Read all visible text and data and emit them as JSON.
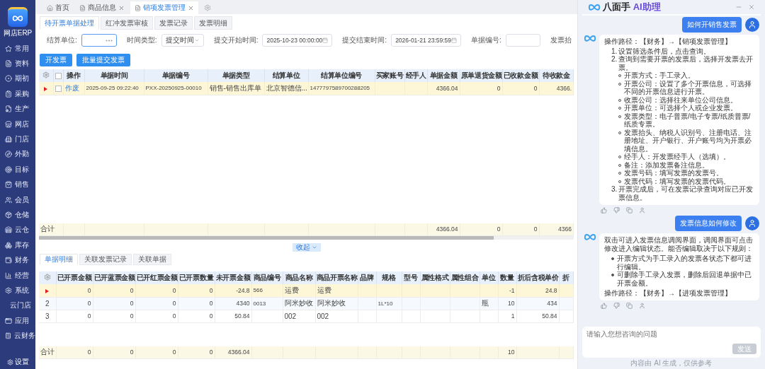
{
  "sidebar": {
    "logo_text": "网店ERP",
    "items": [
      {
        "label": "常用",
        "kind": "main"
      },
      {
        "label": "资料",
        "kind": "main"
      },
      {
        "label": "期初",
        "kind": "main"
      },
      {
        "label": "采购",
        "kind": "main"
      },
      {
        "label": "生产",
        "kind": "main"
      },
      {
        "label": "网店",
        "kind": "main"
      },
      {
        "label": "门店",
        "kind": "main"
      },
      {
        "label": "外勤",
        "kind": "main"
      },
      {
        "label": "目标",
        "kind": "main"
      },
      {
        "label": "销售",
        "kind": "main"
      },
      {
        "label": "会员",
        "kind": "main"
      },
      {
        "label": "仓储",
        "kind": "main"
      },
      {
        "label": "云仓",
        "kind": "main"
      },
      {
        "label": "库存",
        "kind": "main"
      },
      {
        "label": "财务",
        "kind": "main"
      },
      {
        "label": "经营",
        "kind": "main"
      },
      {
        "label": "系统",
        "kind": "main"
      },
      {
        "label": "云门店",
        "kind": "sub"
      },
      {
        "label": "应用",
        "kind": "main"
      },
      {
        "label": "云财务",
        "kind": "main"
      }
    ],
    "footer": "设置"
  },
  "page_tabs": [
    {
      "label": "首页",
      "selected": false,
      "closable": false
    },
    {
      "label": "商品信息",
      "selected": false,
      "closable": true
    },
    {
      "label": "销项发票管理",
      "selected": true,
      "closable": true
    }
  ],
  "sub_tabs": [
    {
      "label": "待开票单据处理",
      "selected": true
    },
    {
      "label": "红冲发票审核",
      "selected": false
    },
    {
      "label": "发票记录",
      "selected": false
    },
    {
      "label": "发票明细",
      "selected": false
    }
  ],
  "filters": [
    {
      "label": "结算单位:",
      "kind": "lookup"
    },
    {
      "label": "时间类型:",
      "kind": "select",
      "value": "提交时间"
    },
    {
      "label": "提交开始时间:",
      "kind": "date",
      "value": "2025-10-23 00:00:00"
    },
    {
      "label": "提交结束时间:",
      "kind": "date",
      "value": "2026-01-21 23:59:59"
    },
    {
      "label": "单据编号:",
      "kind": "text"
    },
    {
      "label": "发票抬",
      "kind": "label"
    }
  ],
  "actions": [
    "开发票",
    "批量提交发票"
  ],
  "upper_table": {
    "header_checked": false,
    "columns": [
      {
        "label": "操作",
        "kind": "action"
      },
      {
        "label": "单据时间",
        "kind": "code"
      },
      {
        "label": "单据编号",
        "kind": "code"
      },
      {
        "label": "单据类型",
        "kind": "text"
      },
      {
        "label": "结算单位",
        "kind": "text"
      },
      {
        "label": "结算单位编号",
        "kind": "code"
      },
      {
        "label": "买家账号",
        "kind": "text"
      },
      {
        "label": "经手人",
        "kind": "text"
      },
      {
        "label": "单据金额",
        "kind": "number"
      },
      {
        "label": "原单退货金额",
        "kind": "number"
      },
      {
        "label": "已收款金额",
        "kind": "number"
      },
      {
        "label": "待收款金",
        "kind": "number"
      }
    ],
    "rows": [
      {
        "selected": true,
        "checked": false,
        "cells": [
          "作废",
          "2025-09-25 09:22:40",
          "PXX-20250925-00010",
          "销售-销售出库单",
          "北京智德信...",
          "1477797589700288205",
          null,
          null,
          "4366.04",
          "0",
          "0",
          "4366."
        ]
      }
    ],
    "total": {
      "label": "合计",
      "cells": [
        null,
        null,
        null,
        null,
        null,
        null,
        null,
        null,
        "4366.04",
        "0",
        "0",
        "4366"
      ]
    }
  },
  "collapse": "收起",
  "detail_tabs": [
    {
      "label": "单据明细",
      "selected": true
    },
    {
      "label": "关联发票记录",
      "selected": false
    },
    {
      "label": "关联单据",
      "selected": false
    }
  ],
  "lower_table": {
    "columns": [
      {
        "label": "已开票金额",
        "kind": "number"
      },
      {
        "label": "已开蓝票金额",
        "kind": "number"
      },
      {
        "label": "已开红票金额",
        "kind": "number"
      },
      {
        "label": "已开票数量",
        "kind": "number"
      },
      {
        "label": "未开票金额",
        "kind": "number"
      },
      {
        "label": "商品编号",
        "kind": "code"
      },
      {
        "label": "商品名称",
        "kind": "text"
      },
      {
        "label": "商品开票名称",
        "kind": "text"
      },
      {
        "label": "品牌",
        "kind": "text"
      },
      {
        "label": "规格",
        "kind": "code"
      },
      {
        "label": "型号",
        "kind": "text"
      },
      {
        "label": "属性格式",
        "kind": "text"
      },
      {
        "label": "属性组合",
        "kind": "text"
      },
      {
        "label": "单位",
        "kind": "text"
      },
      {
        "label": "数量",
        "kind": "number"
      },
      {
        "label": "折后含税单价",
        "kind": "number"
      },
      {
        "label": "折",
        "kind": "number"
      }
    ],
    "rows": [
      {
        "selected": true,
        "cells": [
          "0",
          "0",
          "0",
          "0",
          "-24.8",
          "566",
          "运费",
          "运费",
          null,
          null,
          null,
          null,
          null,
          null,
          "-1",
          "24.8",
          null
        ]
      },
      {
        "selected": false,
        "index": "2",
        "cells": [
          "0",
          "0",
          "0",
          "0",
          "4340",
          "0013",
          "阿米妙收",
          "阿米妙收",
          null,
          "1L*10",
          null,
          null,
          null,
          "瓶",
          "10",
          "434",
          null
        ]
      },
      {
        "selected": false,
        "index": "3",
        "cells": [
          "0",
          "0",
          "0",
          "0",
          "50.84",
          null,
          "002",
          "002",
          null,
          null,
          null,
          null,
          null,
          null,
          "1",
          "50.84",
          null
        ]
      }
    ],
    "total": {
      "label": "合计",
      "cells": [
        "0",
        "0",
        "0",
        "0",
        "4366.04",
        null,
        null,
        null,
        null,
        null,
        null,
        null,
        null,
        null,
        "10",
        null,
        null
      ]
    }
  },
  "assistant": {
    "title_main": "八面手 ",
    "title_accent": "AI助理",
    "messages": [
      {
        "kind": "question",
        "text": "如何开销售发票"
      },
      {
        "kind": "answer",
        "blocks": [
          {
            "kind": "paragraph",
            "text": "操作路径：【财务】→【销项发票管理】"
          },
          {
            "kind": "ordered",
            "items": [
              {
                "number": "1.",
                "text": "设置筛选条件后，点击查询。"
              },
              {
                "number": "2.",
                "text": "查询到需要开票的发票后，选择开发票去开票。",
                "children": [
                  "开票方式：手工录入。",
                  "开票公司：设置了多个开票信息，可选择不同的开票信息进行开票。",
                  "收票公司：选择往来单位公司信息。",
                  "开票单位：可选择个人或企业发票。",
                  "发票类型：电子普票/电子专票/纸质普票/纸质专票。",
                  "发票抬头、纳税人识别号、注册电话、注册地址、开户银行、开户账号均为开票必填信息。",
                  "经手人：开发票经手人（选填）。",
                  "备注：添加发票备注信息。",
                  "发票号码：填写发票的发票号。",
                  "发票代码：填写发票的发票代码。"
                ]
              },
              {
                "number": "3.",
                "text": "开票完成后，可在发票记录查询对应已开发票信息。"
              }
            ]
          }
        ]
      },
      {
        "kind": "question",
        "text": "发票信息如何修改"
      },
      {
        "kind": "answer",
        "blocks": [
          {
            "kind": "paragraph",
            "text": "双击可进入发票信息调阅界面，调阅界面可点击修改进入编辑状态。能否编辑取决于以下规则："
          },
          {
            "kind": "bullets",
            "items": [
              "开票方式为手工录入的发票各状态下都可进行编辑。",
              "可删除手工录入发票，删除后回退单据中已开票金额。"
            ]
          },
          {
            "kind": "paragraph",
            "text": "操作路径：【财务】→【进项发票管理】"
          }
        ]
      }
    ],
    "input": {
      "placeholder": "请输入您想咨询的问题"
    },
    "send": {
      "label": "发送",
      "disabled": true
    },
    "footer": "内容由 AI 生成，仅供参考"
  }
}
